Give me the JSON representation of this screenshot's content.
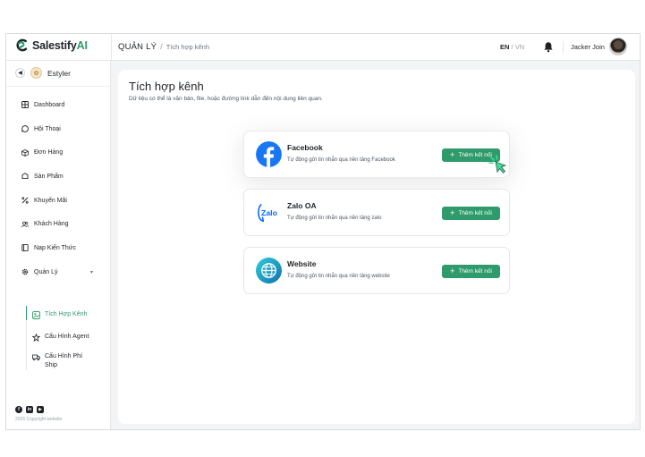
{
  "topbar": {
    "logo_main": "Salestify",
    "logo_accent": "AI",
    "breadcrumb_section": "QUẢN LÝ",
    "breadcrumb_sep": "/",
    "breadcrumb_page": "Tích hợp kênh",
    "lang_en": "EN",
    "lang_sep": "/",
    "lang_vn": "VN",
    "username": "Jacker Join"
  },
  "sidebar": {
    "brand_name": "Estyler",
    "items": [
      {
        "label": "Dashboard",
        "icon": "dashboard-icon"
      },
      {
        "label": "Hội Thoại",
        "icon": "chat-icon"
      },
      {
        "label": "Đơn Hàng",
        "icon": "box-icon"
      },
      {
        "label": "Sản Phẩm",
        "icon": "product-icon"
      },
      {
        "label": "Khuyến Mãi",
        "icon": "percent-icon"
      },
      {
        "label": "Khách Hàng",
        "icon": "users-icon"
      },
      {
        "label": "Nạp Kiến Thức",
        "icon": "knowledge-icon"
      },
      {
        "label": "Quản Lý",
        "icon": "gear-icon"
      }
    ],
    "subitems": [
      {
        "label": "Tích Hợp Kênh",
        "icon": "integration-icon"
      },
      {
        "label": "Cấu Hình Agent",
        "icon": "agent-icon"
      },
      {
        "label": "Cấu Hình Phí Ship",
        "icon": "truck-icon"
      }
    ],
    "copyright": "2025 Copyright website"
  },
  "main": {
    "title": "Tích hợp kênh",
    "subtitle": "Dữ liệu có thể là văn bản, file, hoặc đường link dẫn đến nội dung liên quan.",
    "channels": [
      {
        "name": "Facebook",
        "desc": "Tự động gửi tin nhắn qua nền tảng Facebook",
        "button": "Thêm kết nối",
        "icon": "facebook-icon"
      },
      {
        "name": "Zalo OA",
        "desc": "Tự động gửi tin nhắn qua nền tảng zalo",
        "button": "Thêm kết nối",
        "icon": "zalo-icon"
      },
      {
        "name": "Website",
        "desc": "Tự động gửi tin nhắn qua nền tảng website",
        "button": "Thêm kết nối",
        "icon": "globe-icon"
      }
    ]
  },
  "colors": {
    "accent": "#2f9b6c",
    "facebook": "#1877f2",
    "zalo": "#0068ff"
  }
}
